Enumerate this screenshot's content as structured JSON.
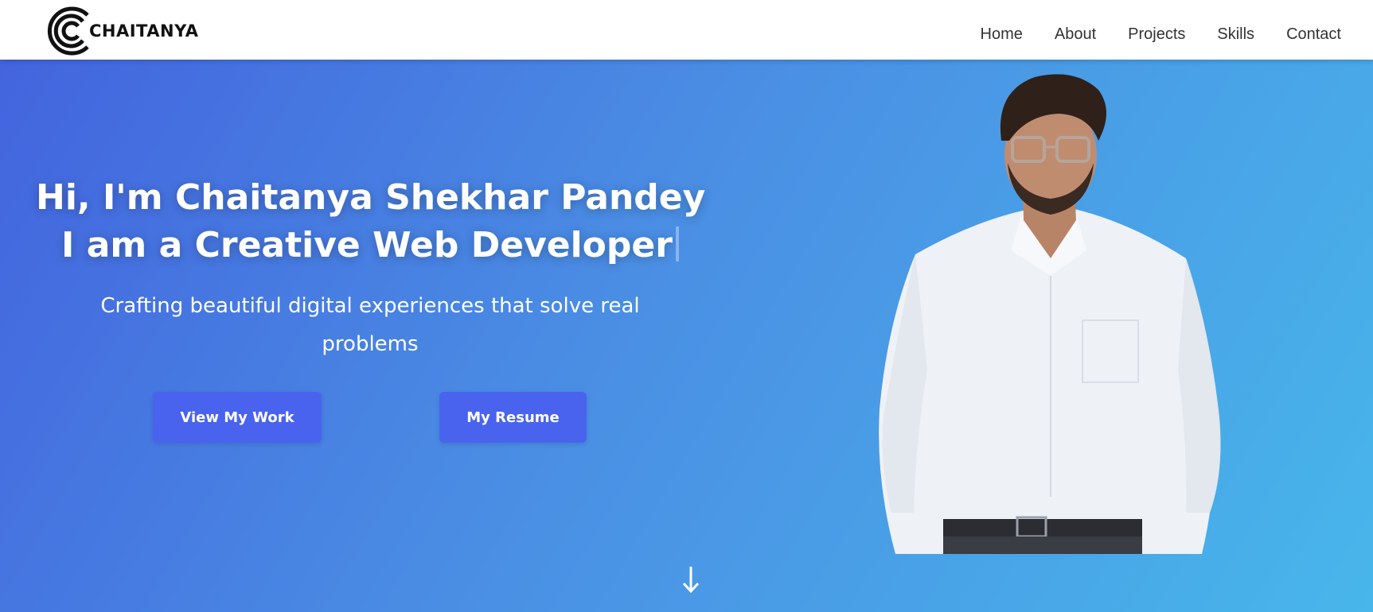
{
  "nav": {
    "logo_text": "CHAITANYA",
    "links": [
      "Home",
      "About",
      "Projects",
      "Skills",
      "Contact"
    ]
  },
  "hero": {
    "title_line1": "Hi, I'm Chaitanya Shekhar Pandey",
    "title_line2": "I am a Creative Web Developer",
    "subtitle": "Crafting beautiful digital experiences that solve real problems",
    "primary_button": "View My Work",
    "secondary_button": "My Resume"
  },
  "icons": {
    "logo": "cc-logo-icon",
    "scroll": "arrow-down-icon"
  },
  "colors": {
    "gradient_start": "#4364de",
    "gradient_end": "#48b6ea",
    "button": "#4a63ee",
    "nav_text": "#333333"
  }
}
